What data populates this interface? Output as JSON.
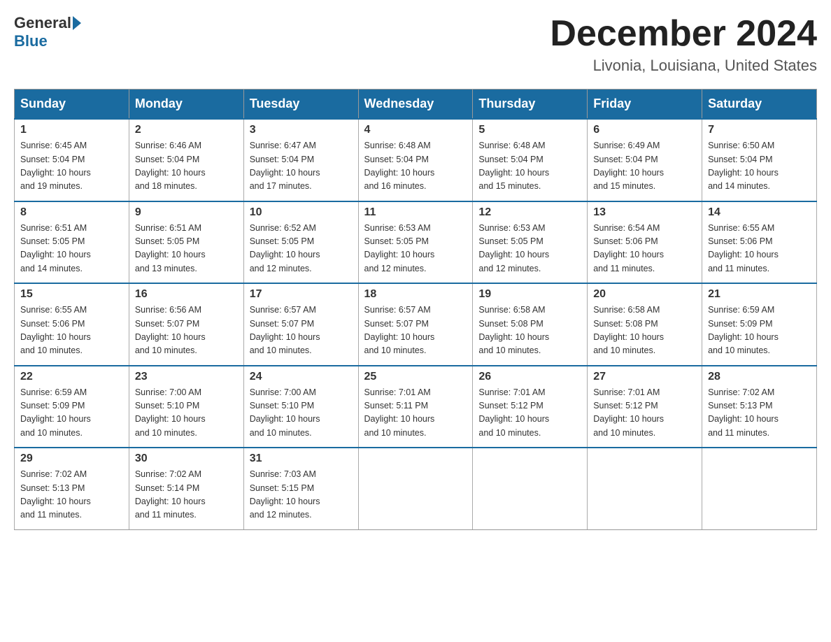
{
  "header": {
    "logo_general": "General",
    "logo_blue": "Blue",
    "month_title": "December 2024",
    "location": "Livonia, Louisiana, United States"
  },
  "days_of_week": [
    "Sunday",
    "Monday",
    "Tuesday",
    "Wednesday",
    "Thursday",
    "Friday",
    "Saturday"
  ],
  "weeks": [
    [
      {
        "day": "1",
        "sunrise": "6:45 AM",
        "sunset": "5:04 PM",
        "daylight": "10 hours and 19 minutes."
      },
      {
        "day": "2",
        "sunrise": "6:46 AM",
        "sunset": "5:04 PM",
        "daylight": "10 hours and 18 minutes."
      },
      {
        "day": "3",
        "sunrise": "6:47 AM",
        "sunset": "5:04 PM",
        "daylight": "10 hours and 17 minutes."
      },
      {
        "day": "4",
        "sunrise": "6:48 AM",
        "sunset": "5:04 PM",
        "daylight": "10 hours and 16 minutes."
      },
      {
        "day": "5",
        "sunrise": "6:48 AM",
        "sunset": "5:04 PM",
        "daylight": "10 hours and 15 minutes."
      },
      {
        "day": "6",
        "sunrise": "6:49 AM",
        "sunset": "5:04 PM",
        "daylight": "10 hours and 15 minutes."
      },
      {
        "day": "7",
        "sunrise": "6:50 AM",
        "sunset": "5:04 PM",
        "daylight": "10 hours and 14 minutes."
      }
    ],
    [
      {
        "day": "8",
        "sunrise": "6:51 AM",
        "sunset": "5:05 PM",
        "daylight": "10 hours and 14 minutes."
      },
      {
        "day": "9",
        "sunrise": "6:51 AM",
        "sunset": "5:05 PM",
        "daylight": "10 hours and 13 minutes."
      },
      {
        "day": "10",
        "sunrise": "6:52 AM",
        "sunset": "5:05 PM",
        "daylight": "10 hours and 12 minutes."
      },
      {
        "day": "11",
        "sunrise": "6:53 AM",
        "sunset": "5:05 PM",
        "daylight": "10 hours and 12 minutes."
      },
      {
        "day": "12",
        "sunrise": "6:53 AM",
        "sunset": "5:05 PM",
        "daylight": "10 hours and 12 minutes."
      },
      {
        "day": "13",
        "sunrise": "6:54 AM",
        "sunset": "5:06 PM",
        "daylight": "10 hours and 11 minutes."
      },
      {
        "day": "14",
        "sunrise": "6:55 AM",
        "sunset": "5:06 PM",
        "daylight": "10 hours and 11 minutes."
      }
    ],
    [
      {
        "day": "15",
        "sunrise": "6:55 AM",
        "sunset": "5:06 PM",
        "daylight": "10 hours and 10 minutes."
      },
      {
        "day": "16",
        "sunrise": "6:56 AM",
        "sunset": "5:07 PM",
        "daylight": "10 hours and 10 minutes."
      },
      {
        "day": "17",
        "sunrise": "6:57 AM",
        "sunset": "5:07 PM",
        "daylight": "10 hours and 10 minutes."
      },
      {
        "day": "18",
        "sunrise": "6:57 AM",
        "sunset": "5:07 PM",
        "daylight": "10 hours and 10 minutes."
      },
      {
        "day": "19",
        "sunrise": "6:58 AM",
        "sunset": "5:08 PM",
        "daylight": "10 hours and 10 minutes."
      },
      {
        "day": "20",
        "sunrise": "6:58 AM",
        "sunset": "5:08 PM",
        "daylight": "10 hours and 10 minutes."
      },
      {
        "day": "21",
        "sunrise": "6:59 AM",
        "sunset": "5:09 PM",
        "daylight": "10 hours and 10 minutes."
      }
    ],
    [
      {
        "day": "22",
        "sunrise": "6:59 AM",
        "sunset": "5:09 PM",
        "daylight": "10 hours and 10 minutes."
      },
      {
        "day": "23",
        "sunrise": "7:00 AM",
        "sunset": "5:10 PM",
        "daylight": "10 hours and 10 minutes."
      },
      {
        "day": "24",
        "sunrise": "7:00 AM",
        "sunset": "5:10 PM",
        "daylight": "10 hours and 10 minutes."
      },
      {
        "day": "25",
        "sunrise": "7:01 AM",
        "sunset": "5:11 PM",
        "daylight": "10 hours and 10 minutes."
      },
      {
        "day": "26",
        "sunrise": "7:01 AM",
        "sunset": "5:12 PM",
        "daylight": "10 hours and 10 minutes."
      },
      {
        "day": "27",
        "sunrise": "7:01 AM",
        "sunset": "5:12 PM",
        "daylight": "10 hours and 10 minutes."
      },
      {
        "day": "28",
        "sunrise": "7:02 AM",
        "sunset": "5:13 PM",
        "daylight": "10 hours and 11 minutes."
      }
    ],
    [
      {
        "day": "29",
        "sunrise": "7:02 AM",
        "sunset": "5:13 PM",
        "daylight": "10 hours and 11 minutes."
      },
      {
        "day": "30",
        "sunrise": "7:02 AM",
        "sunset": "5:14 PM",
        "daylight": "10 hours and 11 minutes."
      },
      {
        "day": "31",
        "sunrise": "7:03 AM",
        "sunset": "5:15 PM",
        "daylight": "10 hours and 12 minutes."
      },
      null,
      null,
      null,
      null
    ]
  ],
  "sunrise_label": "Sunrise:",
  "sunset_label": "Sunset:",
  "daylight_label": "Daylight:"
}
